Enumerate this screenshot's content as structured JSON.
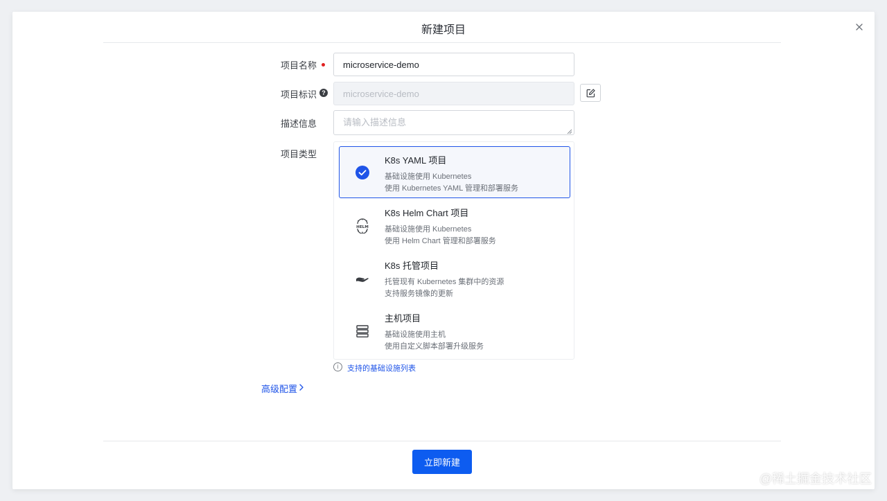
{
  "dialog": {
    "title": "新建项目",
    "close_icon": "close-icon"
  },
  "form": {
    "name_label": "项目名称",
    "name_value": "microservice-demo",
    "key_label": "项目标识",
    "key_value": "microservice-demo",
    "key_help_icon": "question-icon",
    "key_edit_icon": "edit-icon",
    "desc_label": "描述信息",
    "desc_placeholder": "请输入描述信息",
    "type_label": "项目类型"
  },
  "project_types": [
    {
      "title": "K8s YAML 项目",
      "line1": "基础设施使用 Kubernetes",
      "line2": "使用 Kubernetes YAML 管理和部署服务",
      "icon": "check-circle-icon",
      "selected": true
    },
    {
      "title": "K8s Helm Chart 项目",
      "line1": "基础设施使用 Kubernetes",
      "line2": "使用 Helm Chart 管理和部署服务",
      "icon": "helm-icon",
      "selected": false
    },
    {
      "title": "K8s 托管项目",
      "line1": "托管现有 Kubernetes 集群中的资源",
      "line2": "支持服务镜像的更新",
      "icon": "hand-icon",
      "selected": false
    },
    {
      "title": "主机项目",
      "line1": "基础设施使用主机",
      "line2": "使用自定义脚本部署升级服务",
      "icon": "server-icon",
      "selected": false
    }
  ],
  "infra_link": "支持的基础设施列表",
  "advanced_label": "高级配置",
  "submit_label": "立即新建",
  "watermark": "@稀土掘金技术社区",
  "colors": {
    "accent": "#1f54e8",
    "button": "#0d5cf0",
    "required": "#e02020"
  }
}
